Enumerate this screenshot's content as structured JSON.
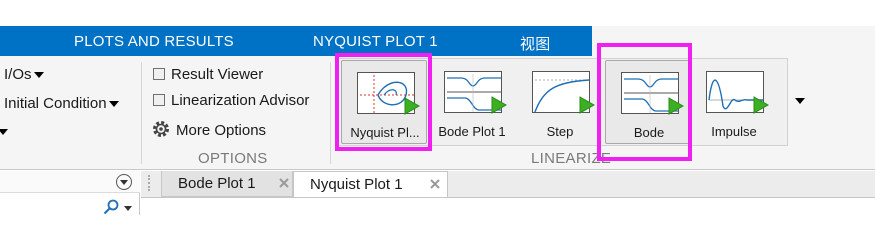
{
  "ribbon_tabs": {
    "plots_and_results": "PLOTS AND RESULTS",
    "nyquist_plot_1": "NYQUIST PLOT 1",
    "view": "视图"
  },
  "setup": {
    "ios_label": "I/Os",
    "initial_condition_label": "Initial Condition"
  },
  "options": {
    "result_viewer_label": "Result Viewer",
    "linearization_advisor_label": "Linearization Advisor",
    "more_options_label": "More Options",
    "section_title": "OPTIONS"
  },
  "linearize": {
    "section_title": "LINEARIZE",
    "gallery": [
      {
        "label": "Nyquist Pl...",
        "icon": "nyquist-plot-icon"
      },
      {
        "label": "Bode Plot 1",
        "icon": "bode-plot-icon"
      },
      {
        "label": "Step",
        "icon": "step-response-icon"
      },
      {
        "label": "Bode",
        "icon": "bode-icon"
      },
      {
        "label": "Impulse",
        "icon": "impulse-response-icon"
      }
    ]
  },
  "documents": {
    "tabs": [
      {
        "label": "Bode Plot 1",
        "active": false
      },
      {
        "label": "Nyquist Plot 1",
        "active": true
      }
    ]
  },
  "colors": {
    "ribbon_blue": "#0072c6",
    "highlight_magenta": "#f020f0",
    "play_green": "#3cb022"
  }
}
